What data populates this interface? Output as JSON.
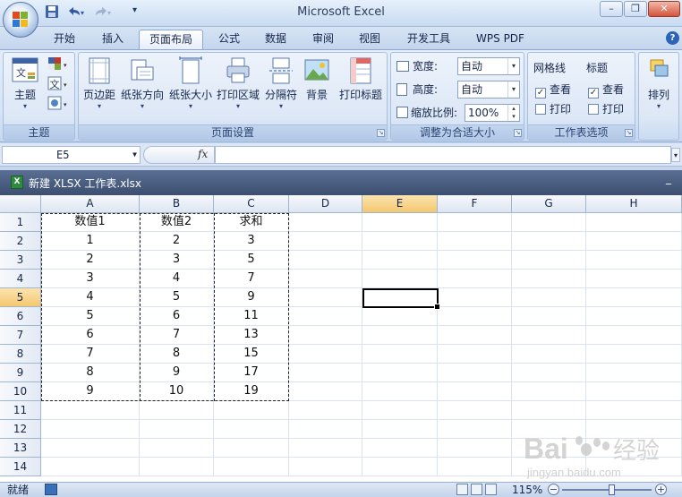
{
  "app": {
    "title": "Microsoft Excel"
  },
  "qat": {
    "save_icon": "save-icon",
    "undo_icon": "undo-icon",
    "redo_icon": "redo-icon"
  },
  "tabs": [
    {
      "label": "开始"
    },
    {
      "label": "插入"
    },
    {
      "label": "页面布局",
      "active": true
    },
    {
      "label": "公式"
    },
    {
      "label": "数据"
    },
    {
      "label": "审阅"
    },
    {
      "label": "视图"
    },
    {
      "label": "开发工具"
    },
    {
      "label": "WPS PDF"
    }
  ],
  "ribbon": {
    "themes": {
      "label": "主题",
      "theme_button": "主题"
    },
    "page_setup": {
      "label": "页面设置",
      "buttons": [
        "页边距",
        "纸张方向",
        "纸张大小",
        "打印区域",
        "分隔符",
        "背景",
        "打印标题"
      ]
    },
    "scale_to_fit": {
      "label": "调整为合适大小",
      "width_label": "宽度:",
      "width_value": "自动",
      "height_label": "高度:",
      "height_value": "自动",
      "scale_label": "缩放比例:",
      "scale_value": "100%"
    },
    "sheet_options": {
      "label": "工作表选项",
      "gridlines_header": "网格线",
      "headings_header": "标题",
      "view_label": "查看",
      "print_label": "打印",
      "gridlines_view": true,
      "gridlines_print": false,
      "headings_view": true,
      "headings_print": false
    },
    "arrange": {
      "label": "排列"
    }
  },
  "formula_bar": {
    "name_box": "E5",
    "fx": "fx",
    "formula": ""
  },
  "workbook": {
    "title": "新建 XLSX 工作表.xlsx"
  },
  "sheet": {
    "columns": [
      "A",
      "B",
      "C",
      "D",
      "E",
      "F",
      "G",
      "H"
    ],
    "selected_column": "E",
    "selected_row": 5,
    "rows": [
      "1",
      "2",
      "3",
      "4",
      "5",
      "6",
      "7",
      "8",
      "9",
      "10",
      "11",
      "12",
      "13",
      "14"
    ],
    "data": [
      [
        "数值1",
        "数值2",
        "求和"
      ],
      [
        "1",
        "2",
        "3"
      ],
      [
        "2",
        "3",
        "5"
      ],
      [
        "3",
        "4",
        "7"
      ],
      [
        "4",
        "5",
        "9"
      ],
      [
        "5",
        "6",
        "11"
      ],
      [
        "6",
        "7",
        "13"
      ],
      [
        "7",
        "8",
        "15"
      ],
      [
        "8",
        "9",
        "17"
      ],
      [
        "9",
        "10",
        "19"
      ]
    ]
  },
  "status": {
    "ready": "就绪",
    "zoom": "115%"
  },
  "watermark": {
    "brand": "Bai",
    "brand2": "经验",
    "url": "jingyan.baidu.com"
  }
}
